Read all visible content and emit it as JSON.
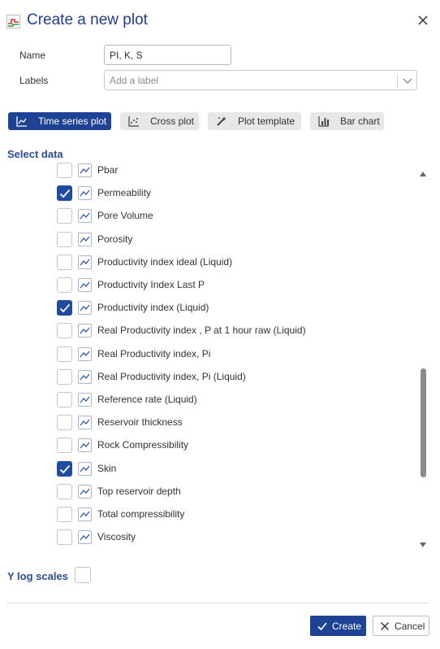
{
  "dialog": {
    "title": "Create a new plot"
  },
  "form": {
    "name_label": "Name",
    "name_value": "PI, K, S",
    "labels_label": "Labels",
    "labels_placeholder": "Add a label"
  },
  "tabs": [
    {
      "label": "Time series plot",
      "active": true,
      "icon": "line-chart-icon"
    },
    {
      "label": "Cross plot",
      "active": false,
      "icon": "scatter-icon"
    },
    {
      "label": "Plot template",
      "active": false,
      "icon": "magic-wand-icon"
    },
    {
      "label": "Bar chart",
      "active": false,
      "icon": "bar-chart-icon"
    }
  ],
  "select_data": {
    "heading": "Select data",
    "items": [
      {
        "label": "Pbar",
        "checked": false
      },
      {
        "label": "Permeability",
        "checked": true
      },
      {
        "label": "Pore Volume",
        "checked": false
      },
      {
        "label": "Porosity",
        "checked": false
      },
      {
        "label": "Productivity index ideal (Liquid)",
        "checked": false
      },
      {
        "label": "Productivity Index Last P",
        "checked": false
      },
      {
        "label": "Productivity index (Liquid)",
        "checked": true
      },
      {
        "label": "Real Productivity index , P at 1 hour raw (Liquid)",
        "checked": false
      },
      {
        "label": "Real Productivity index, Pi",
        "checked": false
      },
      {
        "label": "Real Productivity index, Pi (Liquid)",
        "checked": false
      },
      {
        "label": "Reference rate (Liquid)",
        "checked": false
      },
      {
        "label": "Reservoir thickness",
        "checked": false
      },
      {
        "label": "Rock Compressibility",
        "checked": false
      },
      {
        "label": "Skin",
        "checked": true
      },
      {
        "label": "Top reservoir depth",
        "checked": false
      },
      {
        "label": "Total compressibility",
        "checked": false
      },
      {
        "label": "Viscosity",
        "checked": false
      }
    ]
  },
  "y_log": {
    "label": "Y log scales",
    "checked": false
  },
  "footer": {
    "create_label": "Create",
    "cancel_label": "Cancel"
  },
  "colors": {
    "accent": "#1e4394",
    "heading": "#2a4d95",
    "checkbox_checked": "#1f4ba3"
  }
}
